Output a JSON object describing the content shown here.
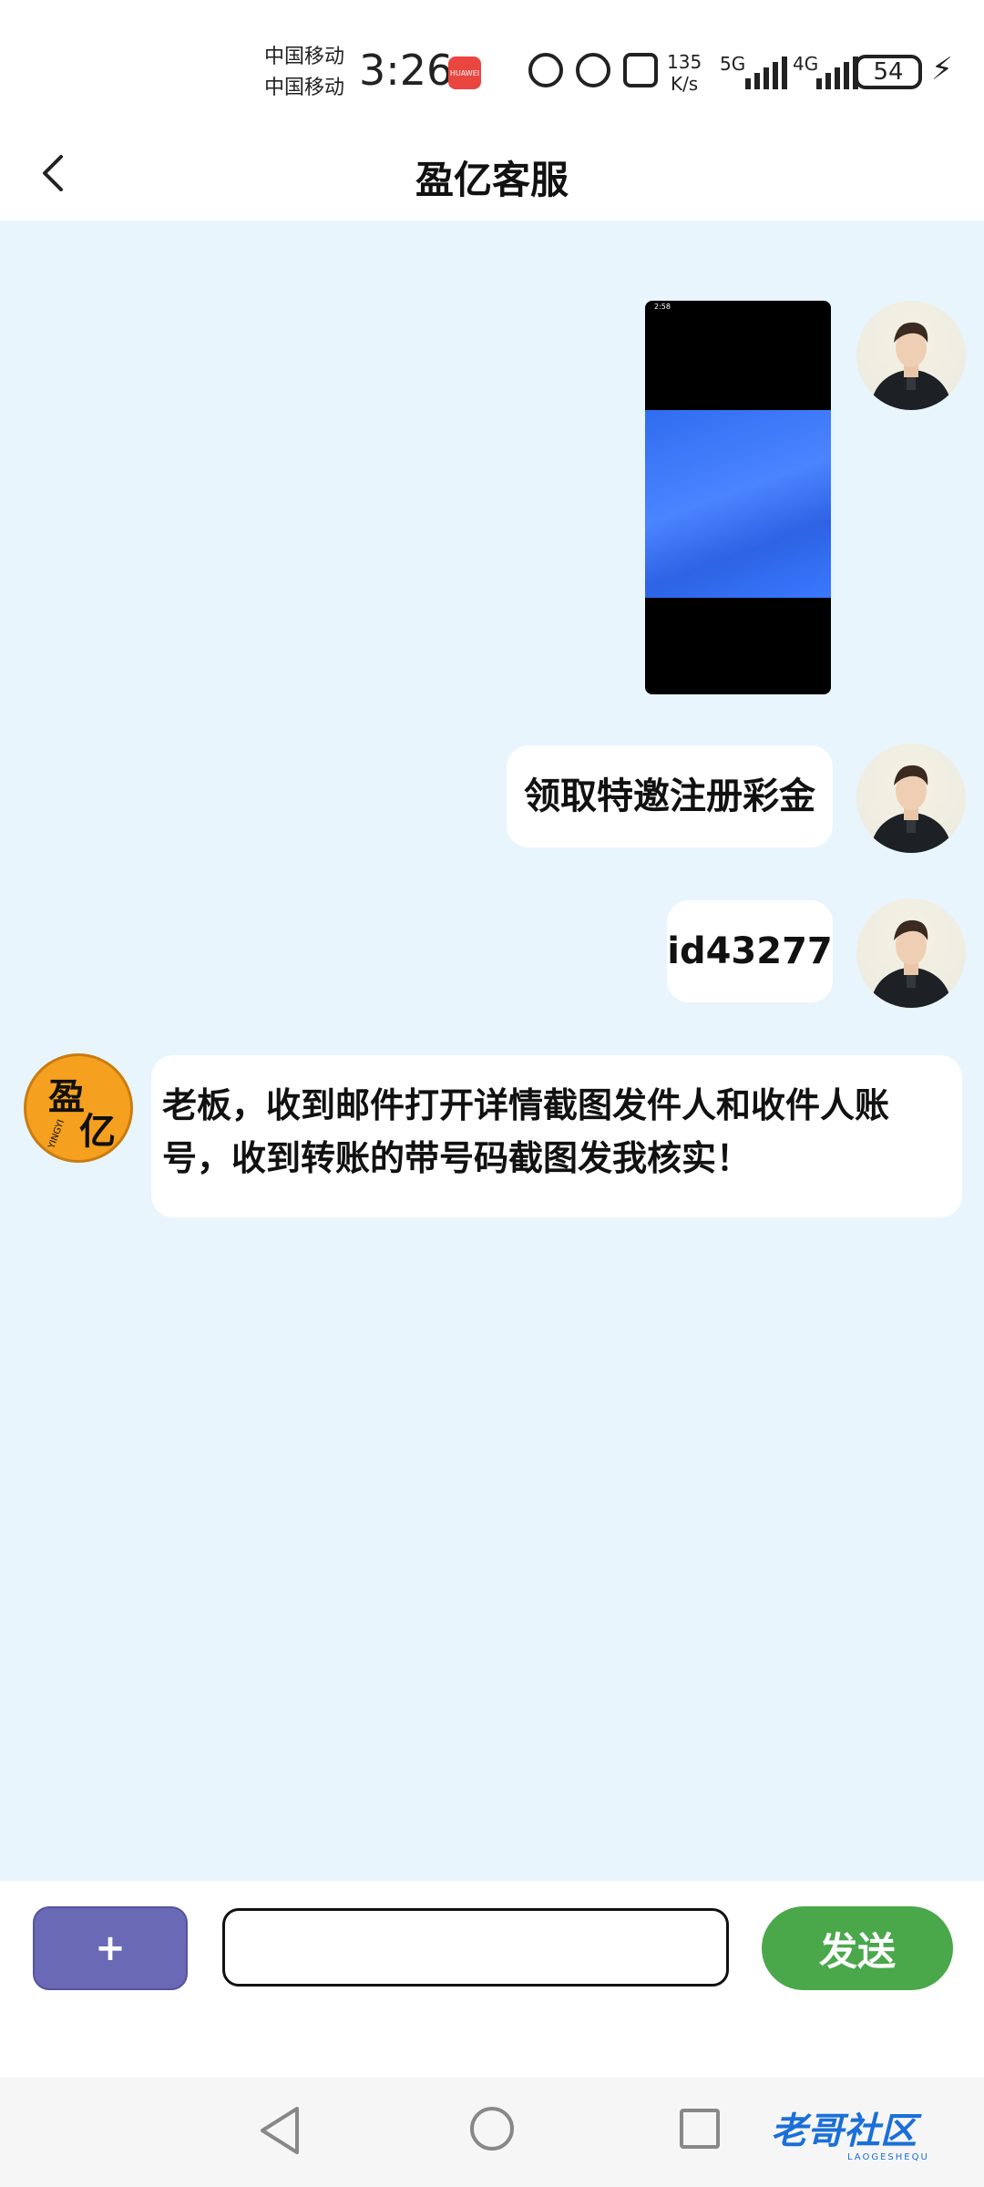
{
  "status_bar": {
    "carrier_1": "中国移动",
    "carrier_2": "中国移动",
    "time": "3:26",
    "net_speed_value": "135",
    "net_speed_unit": "K/s",
    "signal_1": "5G",
    "signal_2": "4G",
    "battery": "54"
  },
  "header": {
    "title": "盈亿客服"
  },
  "messages": [
    {
      "sender": "user",
      "type": "image",
      "image_caption": "2:58"
    },
    {
      "sender": "user",
      "type": "text",
      "text": "领取特邀注册彩金"
    },
    {
      "sender": "user",
      "type": "text",
      "text": "id43277"
    },
    {
      "sender": "agent",
      "type": "text",
      "text": "老板，收到邮件打开详情截图发件人和收件人账号，收到转账的带号码截图发我核实！"
    }
  ],
  "agent_avatar": {
    "logo_text_1": "盈",
    "logo_text_2": "亿",
    "logo_sub": "YINGYI"
  },
  "input_bar": {
    "plus_label": "+",
    "input_value": "",
    "input_placeholder": "",
    "send_label": "发送"
  },
  "watermark": {
    "text": "老哥社区",
    "sub": "LAOGESHEQU"
  },
  "colors": {
    "chat_background": "#e8f5fd",
    "plus_button": "#6a69b6",
    "send_button": "#4aa84b",
    "agent_avatar": "#f5a01e"
  }
}
